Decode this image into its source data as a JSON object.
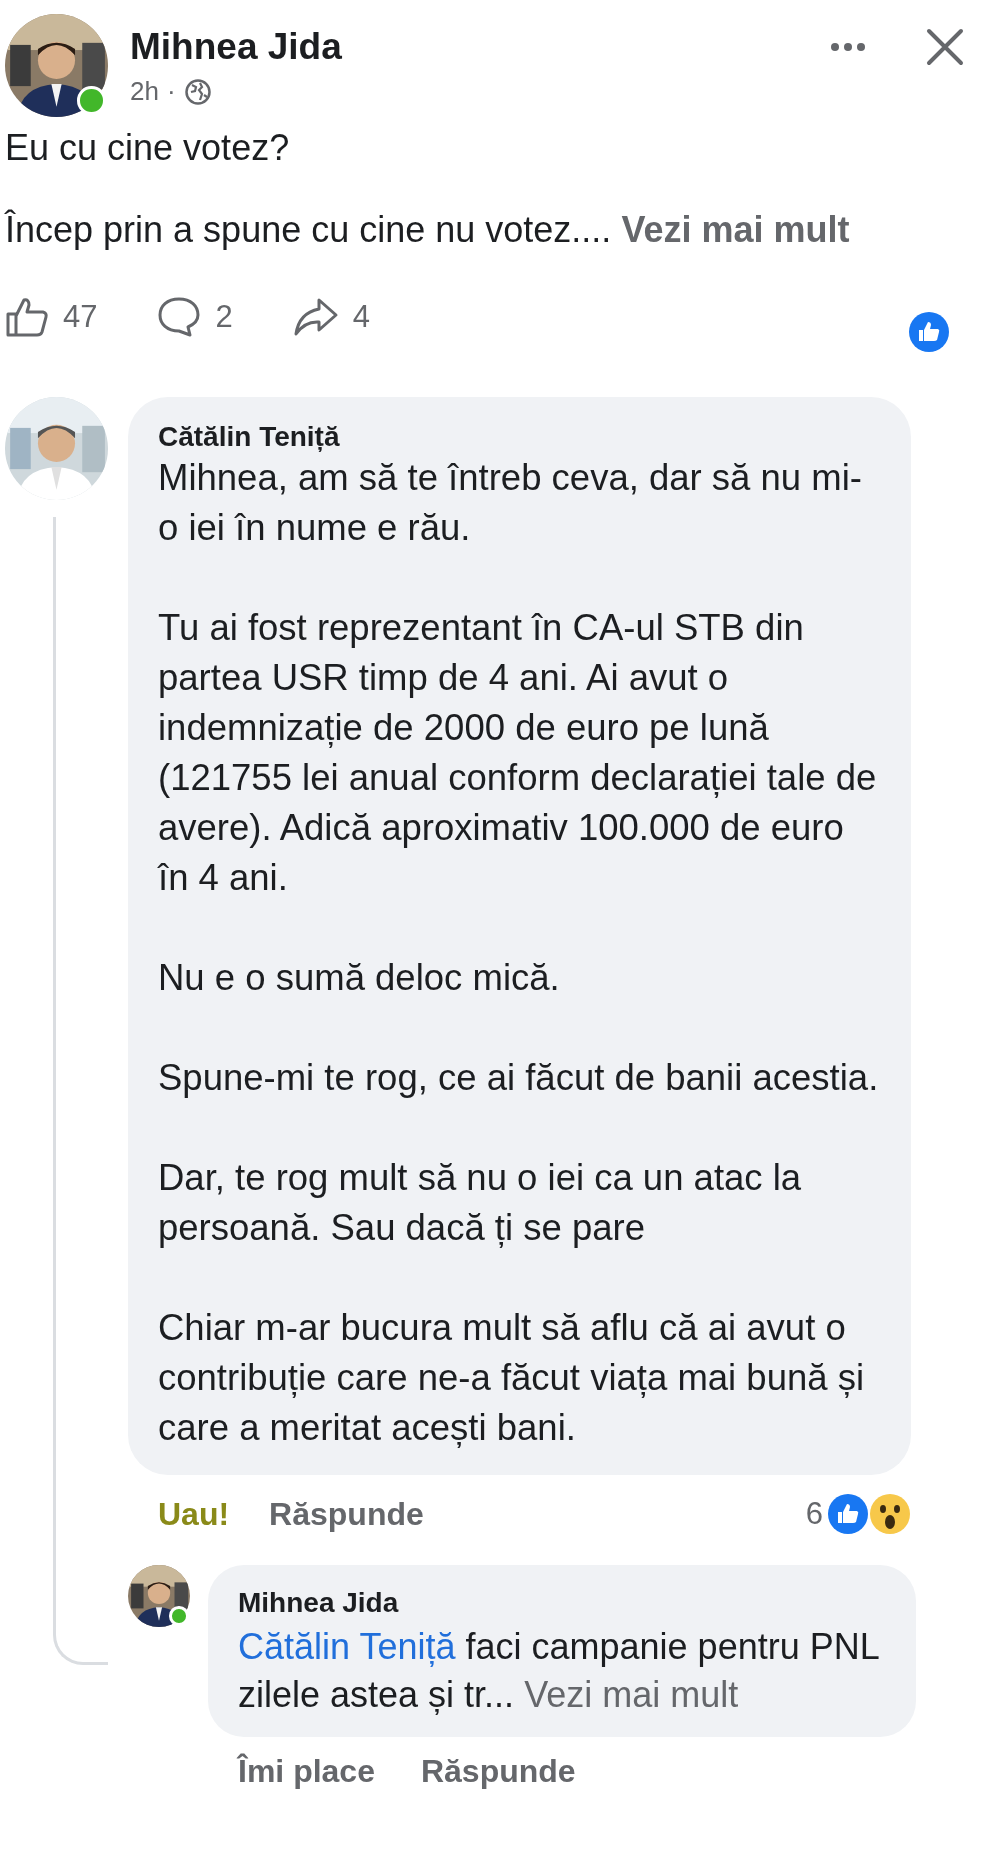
{
  "post": {
    "author": "Mihnea Jida",
    "online": true,
    "time": "2h",
    "separator": "·",
    "paragraphs": [
      "Eu cu cine votez?"
    ],
    "teaser": "Încep prin a spune cu cine nu votez....",
    "see_more": "Vezi mai mult",
    "likes": "47",
    "comments": "2",
    "shares": "4"
  },
  "comment": {
    "author": "Cătălin Teniță",
    "online": false,
    "paragraphs": [
      "Mihnea, am să te întreb ceva, dar să nu mi-o iei în nume e rău.",
      "Tu ai fost reprezentant în CA-ul STB din partea USR timp de 4 ani. Ai avut o indemnizație de 2000 de euro pe lună (121755 lei anual conform declarației tale de avere). Adică aproximativ 100.000 de euro în 4 ani.",
      "Nu e o sumă deloc mică.",
      "Spune-mi te rog, ce ai făcut de banii acestia.",
      "Dar, te rog mult să nu o iei ca un atac la persoană.  Sau dacă ți se pare",
      "Chiar m-ar bucura mult să aflu că ai avut o contribuție care ne-a făcut viața mai bună și care a meritat acești bani."
    ],
    "my_reaction": "Uau!",
    "reply_label": "Răspunde",
    "reaction_count": "6"
  },
  "reply": {
    "author": "Mihnea Jida",
    "online": true,
    "mention": "Cătălin Teniță",
    "text": " faci campanie pentru PNL zilele astea și tr...",
    "see_more": "Vezi mai mult",
    "actions": [
      "Îmi place",
      "Răspunde"
    ]
  }
}
